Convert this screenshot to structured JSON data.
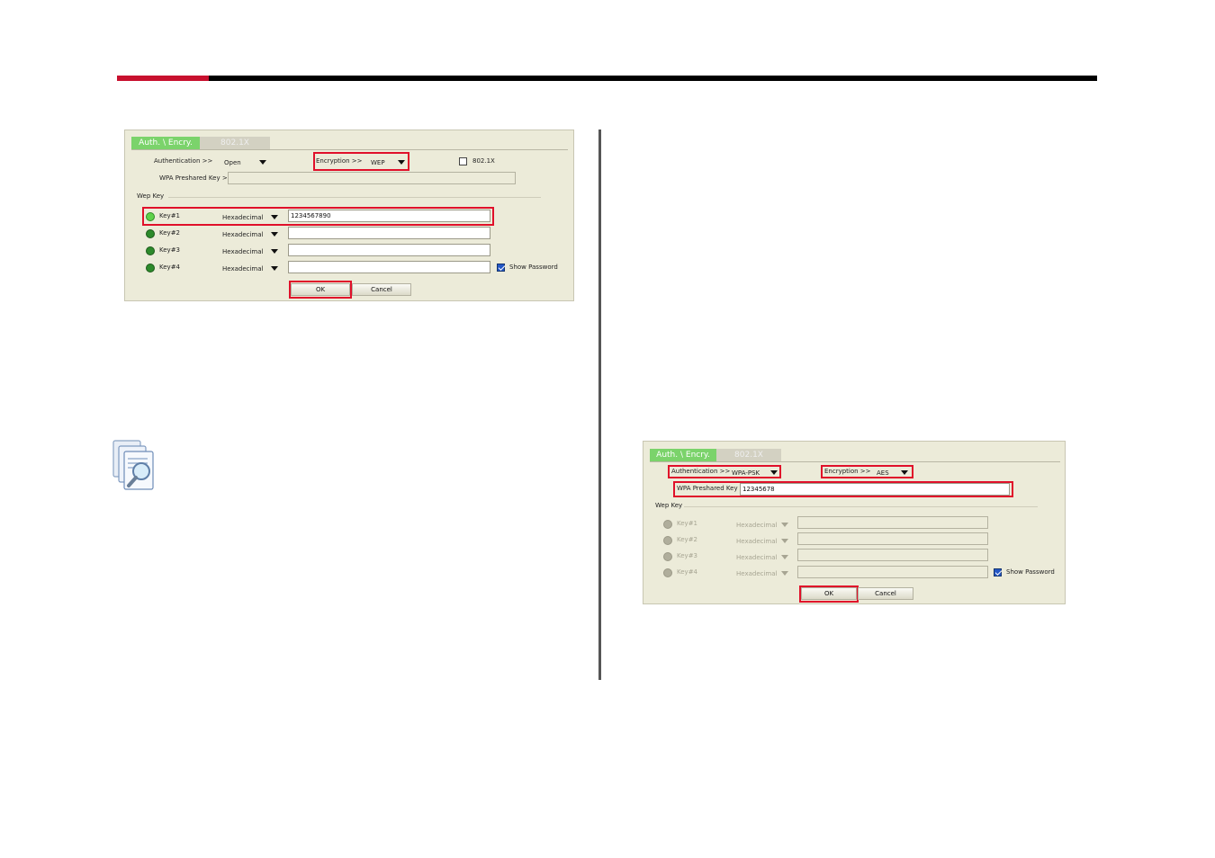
{
  "panel1": {
    "tabs": [
      "Auth. \\ Encry.",
      "802.1X"
    ],
    "authentication_label": "Authentication >>",
    "authentication_value": "Open",
    "encryption_label": "Encryption >>",
    "encryption_value": "WEP",
    "checkbox_8021x_label": "802.1X",
    "wpa_psk_label": "WPA Preshared Key >>",
    "wpa_psk_value": "",
    "wep_key_section": "Wep Key",
    "keys": [
      {
        "label": "Key#1",
        "format": "Hexadecimal",
        "value": "1234567890"
      },
      {
        "label": "Key#2",
        "format": "Hexadecimal",
        "value": ""
      },
      {
        "label": "Key#3",
        "format": "Hexadecimal",
        "value": ""
      },
      {
        "label": "Key#4",
        "format": "Hexadecimal",
        "value": ""
      }
    ],
    "show_password_label": "Show Password",
    "ok_label": "OK",
    "cancel_label": "Cancel"
  },
  "panel2": {
    "tabs": [
      "Auth. \\ Encry.",
      "802.1X"
    ],
    "authentication_label": "Authentication >>",
    "authentication_value": "WPA-PSK",
    "encryption_label": "Encryption >>",
    "encryption_value": "AES",
    "wpa_psk_label": "WPA Preshared Key >>",
    "wpa_psk_value": "12345678",
    "wep_key_section": "Wep Key",
    "keys": [
      {
        "label": "Key#1",
        "format": "Hexadecimal",
        "value": ""
      },
      {
        "label": "Key#2",
        "format": "Hexadecimal",
        "value": ""
      },
      {
        "label": "Key#3",
        "format": "Hexadecimal",
        "value": ""
      },
      {
        "label": "Key#4",
        "format": "Hexadecimal",
        "value": ""
      }
    ],
    "show_password_label": "Show Password",
    "ok_label": "OK",
    "cancel_label": "Cancel"
  },
  "colors": {
    "accent_red": "#c8102e",
    "highlight_red": "#e0102a",
    "tab_green": "#7bd36b",
    "panel_bg": "#ecebd9"
  },
  "icons": [
    "document-search-icon"
  ]
}
